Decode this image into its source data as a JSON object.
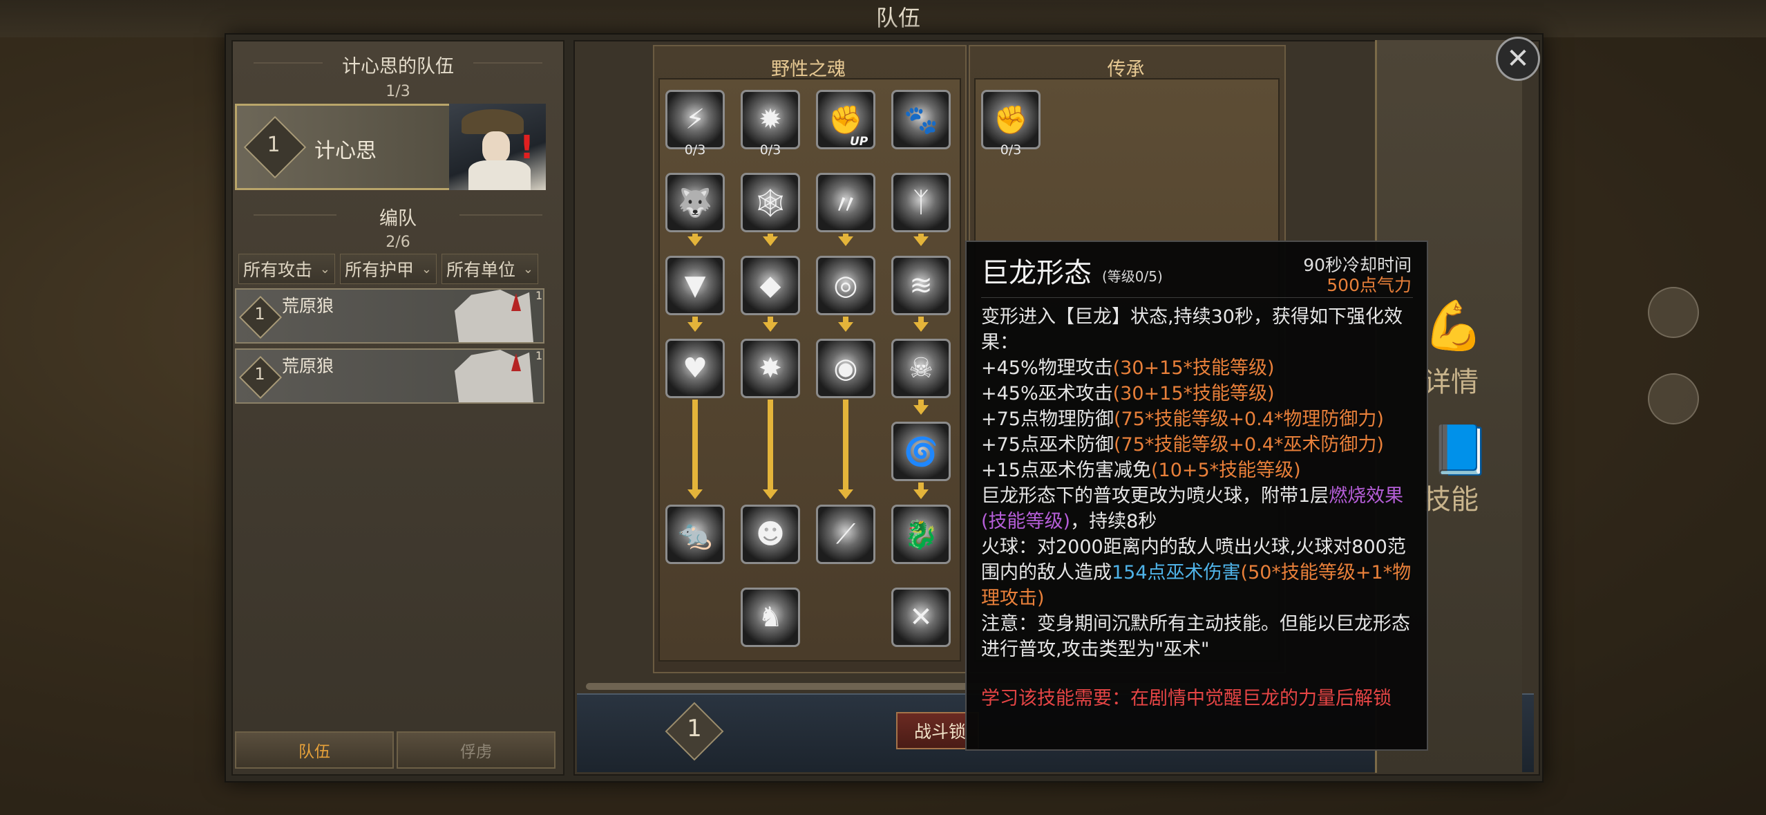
{
  "window_title": "队伍",
  "team_panel": {
    "team_title": "计心思的队伍",
    "team_count": "1/3",
    "leader": {
      "level": "1",
      "name": "计心思"
    },
    "formation_title": "编队",
    "formation_count": "2/6",
    "filters": [
      {
        "label": "所有攻击"
      },
      {
        "label": "所有护甲"
      },
      {
        "label": "所有单位"
      }
    ],
    "units": [
      {
        "name": "荒原狼",
        "rank": "1",
        "level": "1"
      },
      {
        "name": "荒原狼",
        "rank": "1",
        "level": "1"
      }
    ],
    "tabs": {
      "team": "队伍",
      "captives": "俘虏"
    }
  },
  "skill_trees": {
    "wild_soul_title": "野性之魂",
    "inheritance_title": "传承",
    "counts": {
      "c1": "0/3",
      "c2": "0/3",
      "c5": "0/3"
    },
    "up_label": "UP"
  },
  "bottom_bar": {
    "level": "1",
    "battle_label": "战斗锁"
  },
  "side": {
    "text1": "详情",
    "text2": "技能"
  },
  "tooltip": {
    "name": "巨龙形态",
    "level": "(等级0/5)",
    "cooldown": "90秒冷却时间",
    "cost": "500点气力",
    "line1": "变形进入【巨龙】状态,持续30秒，获得如下强化效果：",
    "l2a": "+45%物理攻击",
    "l2b": "(30+15*技能等级)",
    "l3a": "+45%巫术攻击",
    "l3b": "(30+15*技能等级)",
    "l4a": "+75点物理防御",
    "l4b": "(75*技能等级+0.4*物理防御力)",
    "l5a": "+75点巫术防御",
    "l5b": "(75*技能等级+0.4*巫术防御力)",
    "l6a": "+15点巫术伤害减免",
    "l6b": "(10+5*技能等级)",
    "l7a": "巨龙形态下的普攻更改为喷火球，附带1层",
    "l7b": "燃烧效果",
    "l7c": "(技能等级)",
    "l7d": "，持续8秒",
    "l8a": "火球：对2000距离内的敌人喷出火球,火球对800范围内的敌人造成",
    "l8b": "154点巫术伤害",
    "l8c": "(50*技能等级+1*物理攻击)",
    "l9": "注意：变身期间沉默所有主动技能。但能以巨龙形态进行普攻,攻击类型为\"巫术\"",
    "requirement": "学习该技能需要：在剧情中觉醒巨龙的力量后解锁"
  },
  "colors": {
    "accent_gold": "#e4b43a",
    "cost_orange": "#e9803a",
    "requirement_red": "#e64545",
    "burn_purple": "#b55ed8",
    "damage_cyan": "#4fb3e8"
  }
}
